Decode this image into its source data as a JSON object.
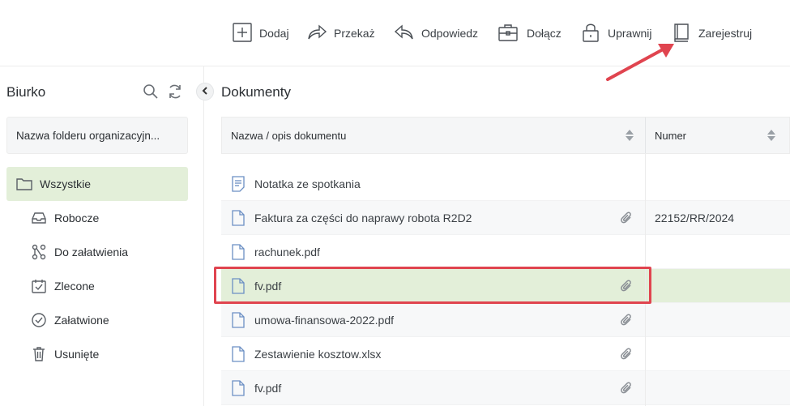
{
  "toolbar": {
    "items": [
      {
        "label": "Dodaj",
        "icon": "plus-square-icon"
      },
      {
        "label": "Przekaż",
        "icon": "forward-arrow-icon"
      },
      {
        "label": "Odpowiedz",
        "icon": "reply-arrow-icon"
      },
      {
        "label": "Dołącz",
        "icon": "briefcase-icon"
      },
      {
        "label": "Uprawnij",
        "icon": "lock-icon"
      },
      {
        "label": "Zarejestruj",
        "icon": "register-book-icon"
      }
    ]
  },
  "sidebar": {
    "title": "Biurko",
    "folder": "Nazwa folderu organizacyjn...",
    "items": [
      {
        "label": "Wszystkie",
        "icon": "folder-icon",
        "active": true
      },
      {
        "label": "Robocze",
        "icon": "inbox-icon"
      },
      {
        "label": "Do załatwienia",
        "icon": "workflow-icon"
      },
      {
        "label": "Zlecone",
        "icon": "calendar-check-icon"
      },
      {
        "label": "Załatwione",
        "icon": "check-circle-icon"
      },
      {
        "label": "Usunięte",
        "icon": "trash-icon"
      }
    ]
  },
  "main": {
    "title": "Dokumenty",
    "columns": {
      "name": "Nazwa / opis dokumentu",
      "number": "Numer"
    },
    "rows": [
      {
        "name": "Notatka ze spotkania",
        "number": "",
        "attachment": false,
        "icon": "note-icon"
      },
      {
        "name": "Faktura za części do naprawy robota R2D2",
        "number": "22152/RR/2024",
        "attachment": true,
        "icon": "document-icon"
      },
      {
        "name": "rachunek.pdf",
        "number": "",
        "attachment": false,
        "icon": "document-icon"
      },
      {
        "name": "fv.pdf",
        "number": "",
        "attachment": true,
        "icon": "document-icon",
        "selected": true
      },
      {
        "name": "umowa-finansowa-2022.pdf",
        "number": "",
        "attachment": true,
        "icon": "document-icon"
      },
      {
        "name": "Zestawienie kosztow.xlsx",
        "number": "",
        "attachment": true,
        "icon": "document-icon"
      },
      {
        "name": "fv.pdf",
        "number": "",
        "attachment": true,
        "icon": "document-icon"
      }
    ]
  },
  "colors": {
    "selected_row": "#e3efd9",
    "annotation": "#e0444f",
    "document_icon": "#6b8fc4"
  }
}
